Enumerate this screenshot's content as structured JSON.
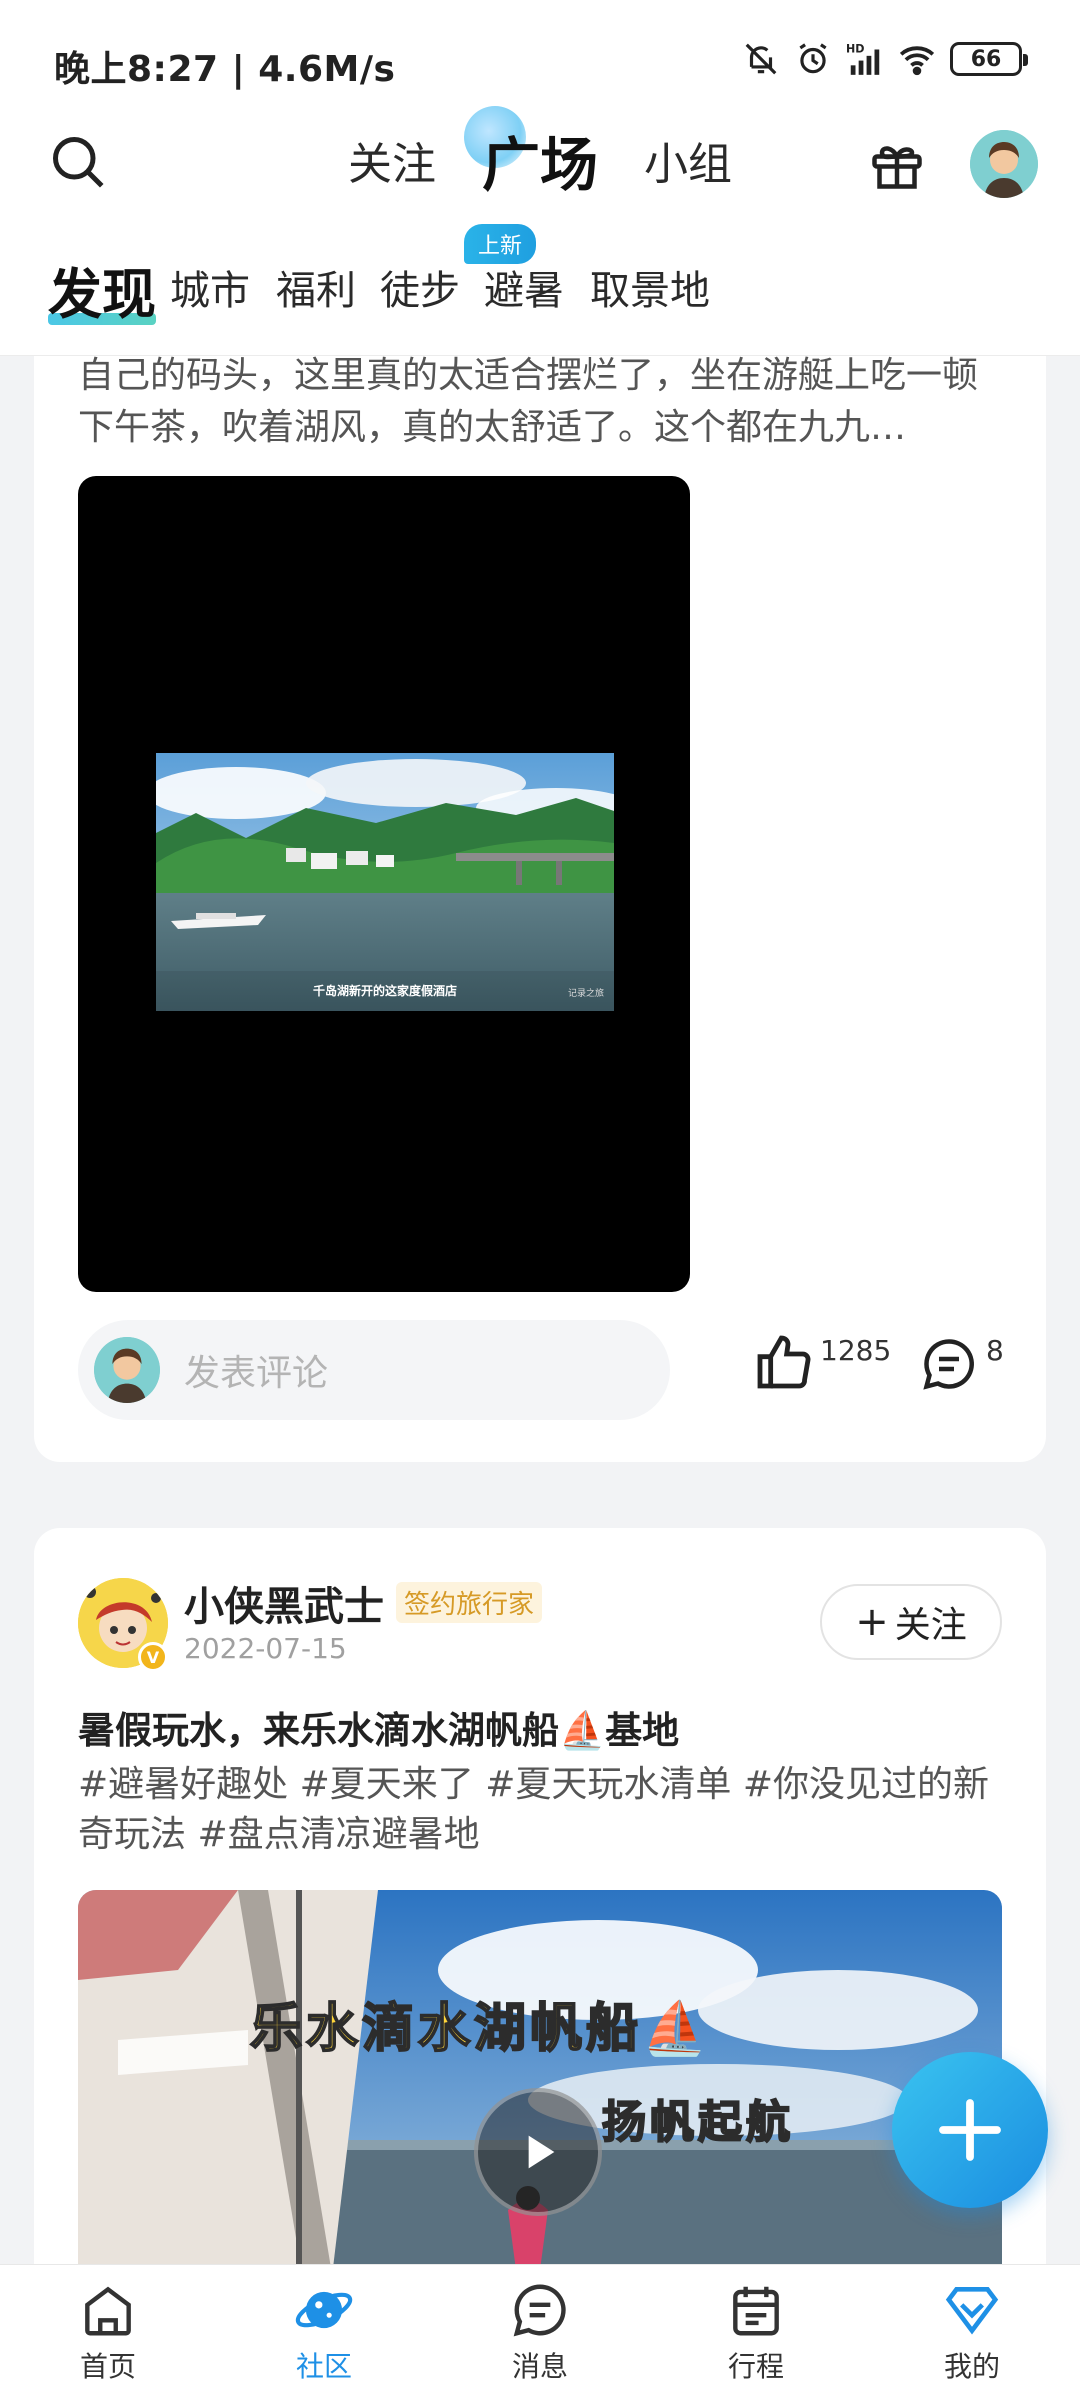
{
  "status_bar": {
    "time": "晚上8:27 | 4.6M/s",
    "battery": "66"
  },
  "header": {
    "nav_tabs": [
      "关注",
      "广场",
      "小组"
    ],
    "active_nav": "广场"
  },
  "categories": {
    "items": [
      "发现",
      "城市",
      "福利",
      "徒步",
      "避暑",
      "取景地"
    ],
    "badge": "上新"
  },
  "post1": {
    "text": "自己的码头，这里真的太适合摆烂了，坐在游艇上吃一顿下午茶，吹着湖风，真的太舒适了。这个都在九九…",
    "video_caption": "千岛湖新开的这家度假酒店",
    "video_watermark": "记录之旅",
    "comment_placeholder": "发表评论",
    "like_count": "1285",
    "comment_count": "8"
  },
  "post2": {
    "author": "小侠黑武士",
    "author_tag": "签约旅行家",
    "date": "2022-07-15",
    "follow_label": "关注",
    "title": "暑假玩水，来乐水滴水湖帆船⛵基地",
    "tags": "#避暑好趣处 #夏天来了 #夏天玩水清单 #你没见过的新奇玩法 #盘点清凉避暑地",
    "media_headline": "乐水滴水湖帆船⛵",
    "media_sub": "扬帆起航"
  },
  "bottom_nav": {
    "items": [
      "首页",
      "社区",
      "消息",
      "行程",
      "我的"
    ]
  },
  "colors": {
    "accent": "#1e90e6",
    "tag_gold": "#d69a26",
    "fab": "#1a8ce0"
  }
}
